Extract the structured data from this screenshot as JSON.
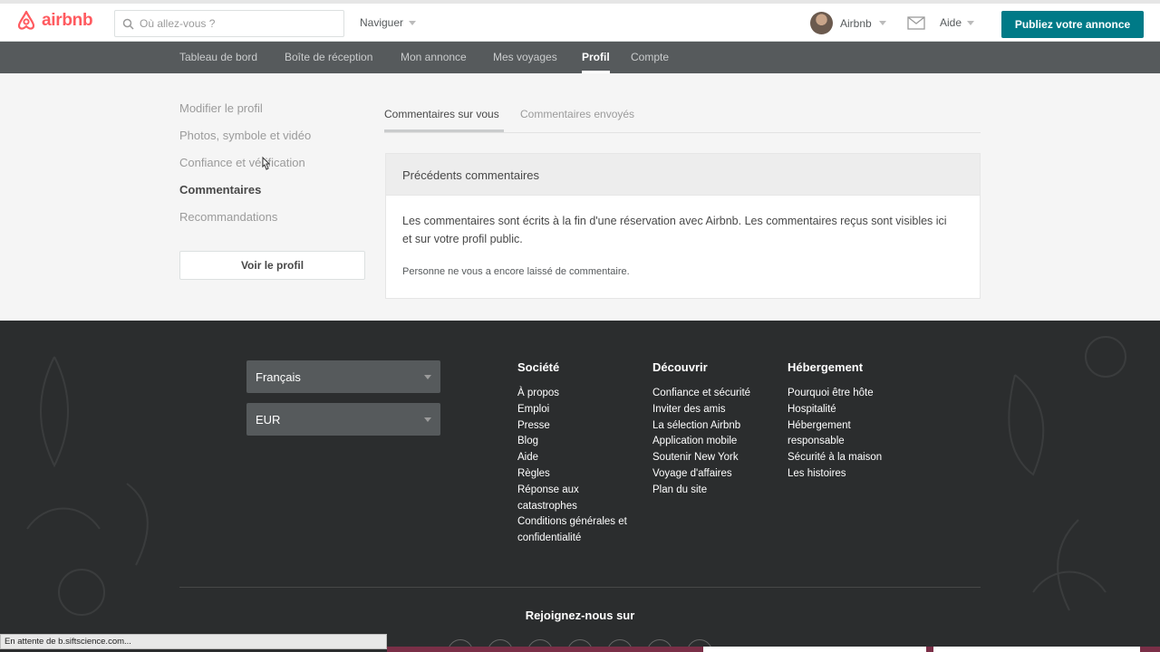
{
  "header": {
    "brand": "airbnb",
    "search_placeholder": "Où allez-vous ?",
    "browse_label": "Naviguer",
    "user_name": "Airbnb",
    "help_label": "Aide",
    "publish_label": "Publiez votre annonce"
  },
  "subnav": {
    "items": [
      {
        "label": "Tableau de bord"
      },
      {
        "label": "Boîte de réception"
      },
      {
        "label": "Mon annonce"
      },
      {
        "label": "Mes voyages"
      },
      {
        "label": "Profil"
      },
      {
        "label": "Compte"
      }
    ],
    "active": "Profil"
  },
  "sidebar": {
    "items": [
      {
        "label": "Modifier le profil"
      },
      {
        "label": "Photos, symbole et vidéo"
      },
      {
        "label": "Confiance et vérification"
      },
      {
        "label": "Commentaires"
      },
      {
        "label": "Recommandations"
      }
    ],
    "active": "Commentaires",
    "view_profile_label": "Voir le profil"
  },
  "reviews": {
    "tabs": [
      {
        "label": "Commentaires sur vous"
      },
      {
        "label": "Commentaires envoyés"
      }
    ],
    "active_tab": "Commentaires sur vous",
    "panel_title": "Précédents commentaires",
    "description": "Les commentaires sont écrits à la fin d'une réservation avec Airbnb. Les commentaires reçus sont visibles ici et sur votre profil public.",
    "empty_note": "Personne ne vous a encore laissé de commentaire."
  },
  "footer": {
    "language": "Français",
    "currency": "EUR",
    "columns": [
      {
        "title": "Société",
        "links": [
          "À propos",
          "Emploi",
          "Presse",
          "Blog",
          "Aide",
          "Règles",
          "Réponse aux",
          "catastrophes",
          "Conditions générales et",
          "confidentialité"
        ]
      },
      {
        "title": "Découvrir",
        "links": [
          "Confiance et sécurité",
          "Inviter des amis",
          "La sélection Airbnb",
          "Application mobile",
          "Soutenir New York",
          "Voyage d'affaires",
          "Plan du site"
        ]
      },
      {
        "title": "Hébergement",
        "links": [
          "Pourquoi être hôte",
          "Hospitalité",
          "Hébergement",
          "responsable",
          "Sécurité à la maison",
          "Les histoires"
        ]
      }
    ],
    "join_label": "Rejoignez-nous sur"
  },
  "statusbar": {
    "text": "En attente de b.siftscience.com..."
  },
  "colors": {
    "brand": "#ff5a5f",
    "primary_button": "#007a87",
    "subnav_bg": "#565a5c",
    "footer_bg": "#2b2d2e"
  }
}
